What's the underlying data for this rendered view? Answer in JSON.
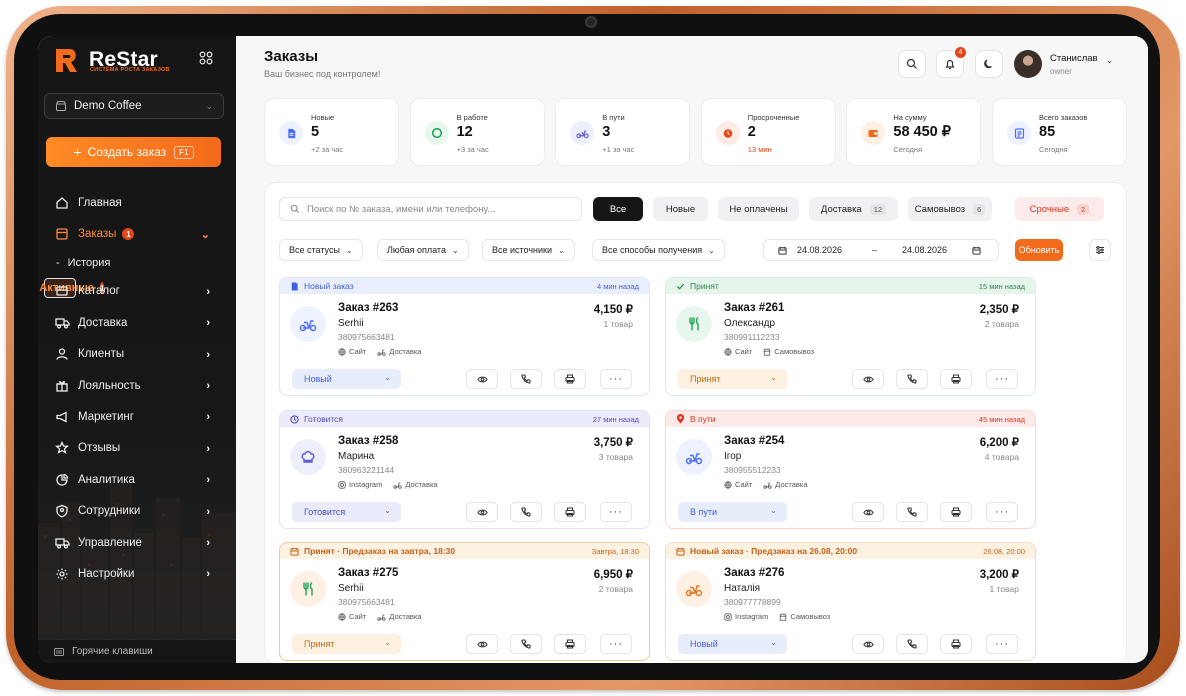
{
  "brand": {
    "name": "ReStar",
    "tagline": "СИСТЕМА РОСТА ЗАКАЗОВ"
  },
  "workspace": "Demo Coffee",
  "create_button": {
    "label": "Создать заказ",
    "shortcut": "F1"
  },
  "nav": [
    {
      "label": "Главная",
      "icon": "home-icon"
    },
    {
      "label": "Заказы",
      "icon": "orders-icon",
      "badge": "1",
      "open": true
    },
    {
      "label": "Каталог",
      "icon": "catalog-icon"
    },
    {
      "label": "Доставка",
      "icon": "truck-icon"
    },
    {
      "label": "Клиенты",
      "icon": "users-icon"
    },
    {
      "label": "Лояльность",
      "icon": "gift-icon"
    },
    {
      "label": "Маркетинг",
      "icon": "megaphone-icon"
    },
    {
      "label": "Отзывы",
      "icon": "star-icon"
    },
    {
      "label": "Аналитика",
      "icon": "analytics-icon"
    },
    {
      "label": "Сотрудники",
      "icon": "shield-user-icon"
    },
    {
      "label": "Управление",
      "icon": "truck-icon"
    },
    {
      "label": "Настройки",
      "icon": "gear-icon"
    }
  ],
  "subnav": [
    {
      "label": "Активные",
      "badge": "1",
      "bullet": "-"
    },
    {
      "label": "История",
      "bullet": "-"
    }
  ],
  "hotkeys": "Горячие клавиши",
  "header": {
    "title": "Заказы",
    "subtitle": "Ваш бизнес под контролем!",
    "notifications": "4",
    "user_name": "Станислав",
    "user_role": "owner"
  },
  "stats": [
    {
      "label": "Новые",
      "value": "5",
      "sub": "+2 за час",
      "color": "#4a6cf7"
    },
    {
      "label": "В работе",
      "value": "12",
      "sub": "+3 за час",
      "color": "#22a35a"
    },
    {
      "label": "В пути",
      "value": "3",
      "sub": "+1 за час",
      "color": "#5b5bd6"
    },
    {
      "label": "Просроченные",
      "value": "2",
      "sub": "13 мин",
      "color": "#e3461a"
    },
    {
      "label": "На сумму",
      "value": "58 450 ₽",
      "sub": "Сегодня",
      "color": "#f26a1b"
    },
    {
      "label": "Всего заказов",
      "value": "85",
      "sub": "Сегодня",
      "color": "#4a6cf7"
    }
  ],
  "search_placeholder": "Поиск по № заказа, имени или телефону...",
  "tabs": [
    {
      "label": "Все"
    },
    {
      "label": "Новые"
    },
    {
      "label": "Не оплачены"
    },
    {
      "label": "Доставка",
      "count": "12"
    },
    {
      "label": "Самовывоз",
      "count": "6"
    },
    {
      "label": "Срочные",
      "count": "2"
    }
  ],
  "filters": [
    "Все статусы",
    "Любая оплата",
    "Все источники",
    "Все способы получения"
  ],
  "date_from": "24.08.2026",
  "date_sep": "–",
  "date_to": "24.08.2026",
  "refresh_label": "Обновить",
  "orders": [
    {
      "head": "Новый заказ",
      "time": "4 мин назад",
      "id": "Заказ #263",
      "name": "Serhii",
      "phone": "380975663481",
      "source": "Сайт",
      "method": "Доставка",
      "price": "4,150 ₽",
      "qty": "1 товар",
      "status": "Новый"
    },
    {
      "head": "Принят",
      "time": "15 мин назад",
      "id": "Заказ #261",
      "name": "Олександр",
      "phone": "380991112233",
      "source": "Сайт",
      "method": "Самовывоз",
      "price": "2,350 ₽",
      "qty": "2 товара",
      "status": "Принят"
    },
    {
      "head": "Готовится",
      "time": "27 мин назад",
      "id": "Заказ #258",
      "name": "Марина",
      "phone": "380963221144",
      "source": "Instagram",
      "method": "Доставка",
      "price": "3,750 ₽",
      "qty": "3 товара",
      "status": "Готовится"
    },
    {
      "head": "В пути",
      "time": "45 мин назад",
      "id": "Заказ #254",
      "name": "Ігор",
      "phone": "380955512233",
      "source": "Сайт",
      "method": "Доставка",
      "price": "6,200 ₽",
      "qty": "4 товара",
      "status": "В пути"
    },
    {
      "head": "Принят · Предзаказ на завтра, 18:30",
      "time": "Завтра, 18:30",
      "id": "Заказ #275",
      "name": "Serhii",
      "phone": "380975663481",
      "source": "Сайт",
      "method": "Доставка",
      "price": "6,950 ₽",
      "qty": "2 товара",
      "status": "Принят"
    },
    {
      "head": "Новый заказ · Предзаказ на 26.08, 20:00",
      "time": "26.08, 20:00",
      "id": "Заказ #276",
      "name": "Наталія",
      "phone": "380977778899",
      "source": "Instagram",
      "method": "Самовывоз",
      "price": "3,200 ₽",
      "qty": "1 товар",
      "status": "Новый"
    }
  ]
}
